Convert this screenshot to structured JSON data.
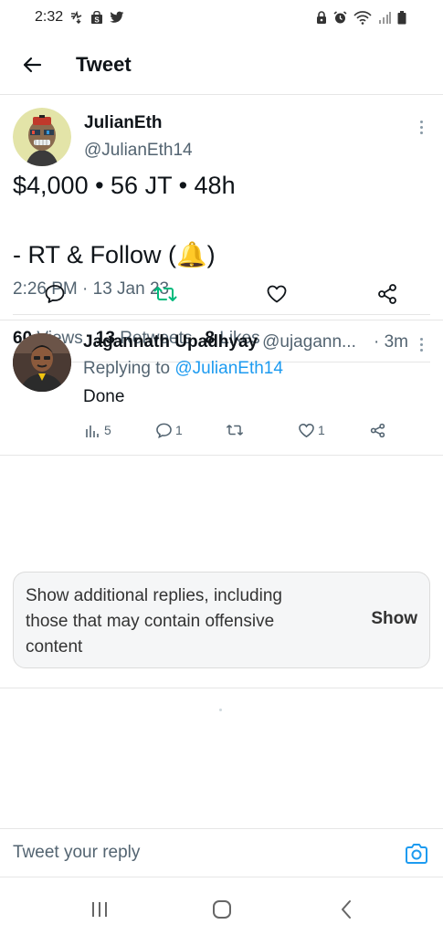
{
  "status_bar": {
    "time": "2:32",
    "left_icons": [
      "download-status-icon",
      "shopping-bag-icon",
      "twitter-bird-icon"
    ],
    "right_icons": [
      "lock-icon",
      "alarm-icon",
      "wifi-icon",
      "signal-icon",
      "battery-icon"
    ]
  },
  "header": {
    "title": "Tweet",
    "back_icon": "arrow-left-icon"
  },
  "tweet": {
    "author_name": "JulianEth",
    "author_handle": "@JulianEth14",
    "text": "$4,000 • 56 JT • 48h\n\n- RT & Follow (🔔)",
    "timestamp": "2:26 PM · 13 Jan 23",
    "stats": {
      "views_count": "60",
      "views_label": "Views",
      "retweets_count": "13",
      "retweets_label": "Retweets",
      "likes_count": "8",
      "likes_label": "Likes"
    },
    "actions": [
      "reply-icon",
      "retweet-icon",
      "like-icon",
      "share-icon"
    ],
    "retweet_color": "#00ba7c"
  },
  "reply": {
    "name": "Jagannath Upadhyay",
    "handle": "@ujagann...",
    "time": "· 3m",
    "replying_prefix": "Replying to",
    "replying_to": "@JulianEth14",
    "text": "Done",
    "views_count": "5",
    "replies_count": "1",
    "likes_count": "1"
  },
  "more_replies": {
    "text": "Show additional replies, including those that may contain offensive content",
    "button": "Show"
  },
  "reply_bar": {
    "placeholder": "Tweet your reply"
  },
  "colors": {
    "accent": "#1d9bf0",
    "text_primary": "#0f1419",
    "text_secondary": "#536471"
  },
  "nav_bar": [
    "recent-apps-icon",
    "home-icon",
    "back-icon"
  ]
}
